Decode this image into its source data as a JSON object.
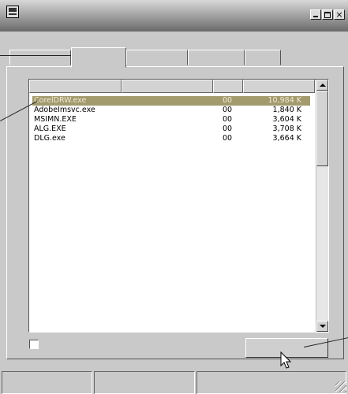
{
  "window": {
    "title": "",
    "icon": "system-menu-icon",
    "caption_buttons": {
      "minimize": "",
      "maximize": "",
      "close": "×"
    }
  },
  "tabs": [
    {
      "label": ""
    },
    {
      "label": ""
    },
    {
      "label": ""
    },
    {
      "label": ""
    },
    {
      "label": ""
    }
  ],
  "process_list": {
    "columns": [
      "",
      "",
      "",
      ""
    ],
    "rows": [
      {
        "name": "CorelDRW.exe",
        "cpu": "00",
        "mem": "10,984 K",
        "selected": true
      },
      {
        "name": "AdobeImsvc.exe",
        "cpu": "00",
        "mem": "1,840 K",
        "selected": false
      },
      {
        "name": "MSIMN.EXE",
        "cpu": "00",
        "mem": "3,604 K",
        "selected": false
      },
      {
        "name": "ALG.EXE",
        "cpu": "00",
        "mem": "3,708 K",
        "selected": false
      },
      {
        "name": "DLG.exe",
        "cpu": "00",
        "mem": "3,664 K",
        "selected": false
      }
    ]
  },
  "show_all_checkbox": {
    "label": "",
    "checked": false
  },
  "end_process_button": {
    "label": ""
  },
  "status_bar": {
    "panes": [
      "",
      "",
      ""
    ]
  },
  "colors": {
    "selection": "#a39a6d",
    "selection_text": "#f0ead8"
  }
}
